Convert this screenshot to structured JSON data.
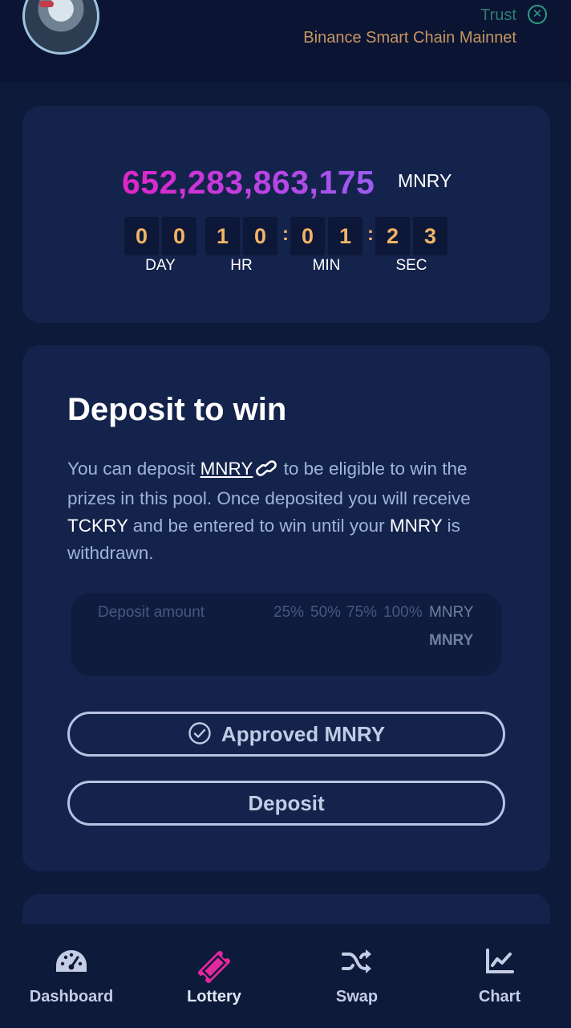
{
  "header": {
    "wallet_name": "Trust",
    "network": "Binance Smart Chain Mainnet"
  },
  "prize": {
    "amount": "652,283,863,175",
    "unit": "MNRY"
  },
  "countdown": {
    "digits": [
      "0",
      "0",
      "1",
      "0",
      "0",
      "1",
      "2",
      "3"
    ],
    "labels": [
      "DAY",
      "HR",
      "MIN",
      "SEC"
    ]
  },
  "deposit": {
    "title": "Deposit to win",
    "desc_1": "You can deposit ",
    "token_link": "MNRY",
    "desc_2": " to be eligible to win the prizes in this pool. Once deposited you will receive ",
    "receipt_token": "TCKRY",
    "desc_3": " and be entered to win until your ",
    "token": "MNRY",
    "desc_4": " is withdrawn.",
    "amount_placeholder": "Deposit amount",
    "percents": [
      "25%",
      "50%",
      "75%",
      "100%"
    ],
    "unit": "MNRY",
    "balance_unit": "MNRY",
    "approved_label": "Approved MNRY",
    "deposit_label": "Deposit"
  },
  "nav": {
    "items": [
      {
        "label": "Dashboard",
        "icon": "gauge-icon"
      },
      {
        "label": "Lottery",
        "icon": "ticket-icon"
      },
      {
        "label": "Swap",
        "icon": "shuffle-icon"
      },
      {
        "label": "Chart",
        "icon": "chart-line-icon"
      }
    ],
    "active": "Lottery",
    "active_color": "#e5279e"
  }
}
